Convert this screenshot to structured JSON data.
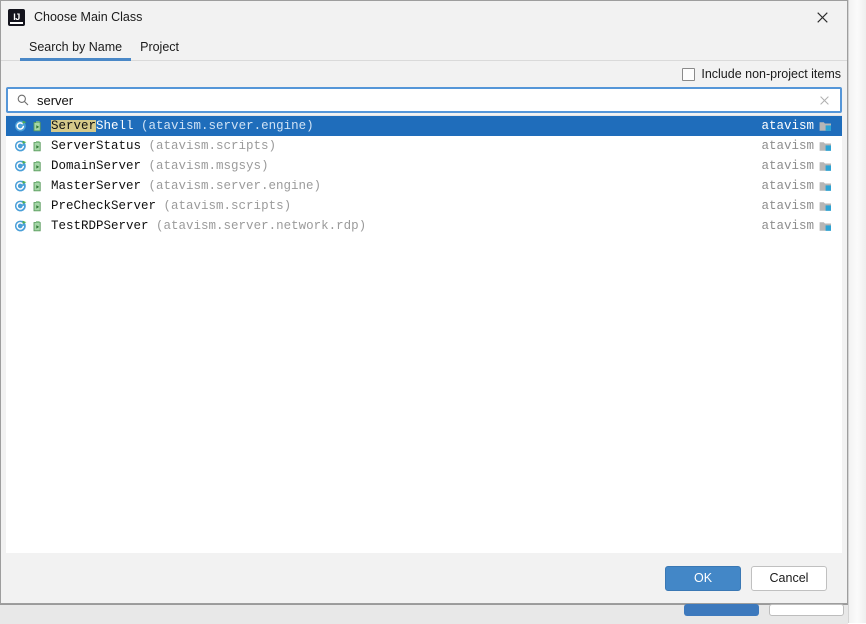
{
  "window": {
    "title": "Choose Main Class",
    "app_logo": "intellij-idea-logo",
    "close_icon": "close-icon"
  },
  "tabs": [
    {
      "label": "Search by Name",
      "active": true
    },
    {
      "label": "Project",
      "active": false
    }
  ],
  "options": {
    "include_non_project": {
      "label": "Include non-project items",
      "checked": false
    }
  },
  "search": {
    "icon": "search-icon",
    "value": "server",
    "placeholder": "",
    "clear_icon": "clear-icon"
  },
  "results": {
    "match_term": "Server",
    "items": [
      {
        "class_name": "ServerShell",
        "match_prefix": "Server",
        "match_rest": "Shell",
        "package": "(atavism.server.engine)",
        "module": "atavism",
        "selected": true
      },
      {
        "class_name": "ServerStatus",
        "match_prefix": "",
        "match_rest": "ServerStatus",
        "package": "(atavism.scripts)",
        "module": "atavism",
        "selected": false
      },
      {
        "class_name": "DomainServer",
        "match_prefix": "",
        "match_rest": "DomainServer",
        "package": "(atavism.msgsys)",
        "module": "atavism",
        "selected": false
      },
      {
        "class_name": "MasterServer",
        "match_prefix": "",
        "match_rest": "MasterServer",
        "package": "(atavism.server.engine)",
        "module": "atavism",
        "selected": false
      },
      {
        "class_name": "PreCheckServer",
        "match_prefix": "",
        "match_rest": "PreCheckServer",
        "package": "(atavism.scripts)",
        "module": "atavism",
        "selected": false
      },
      {
        "class_name": "TestRDPServer",
        "match_prefix": "",
        "match_rest": "TestRDPServer",
        "package": "(atavism.server.network.rdp)",
        "module": "atavism",
        "selected": false
      }
    ]
  },
  "footer": {
    "ok_label": "OK",
    "cancel_label": "Cancel"
  },
  "colors": {
    "selection_blue": "#1f6dbb",
    "focus_border": "#5596d8",
    "tab_underline": "#4a88c7",
    "default_button": "#4387c7",
    "match_highlight": "#d6c98a",
    "package_gray": "#9b9b9b"
  }
}
